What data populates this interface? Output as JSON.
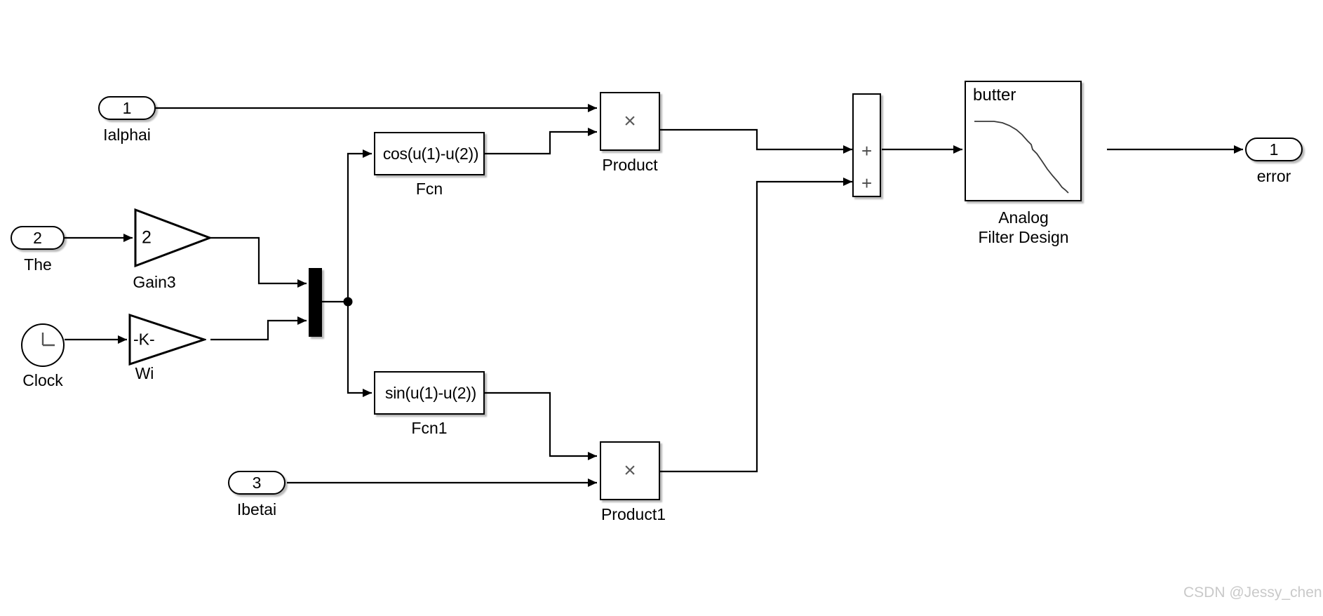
{
  "diagram": {
    "title": "Simulink block diagram",
    "watermark": "CSDN @Jessy_chen",
    "line_color": "#000000",
    "block_fill": "#ffffff"
  },
  "ports": {
    "in1": {
      "number": "1",
      "label": "Ialphai"
    },
    "in2": {
      "number": "2",
      "label": "The"
    },
    "in3": {
      "number": "3",
      "label": "Ibetai"
    },
    "out1": {
      "number": "1",
      "label": "error"
    }
  },
  "blocks": {
    "gain3": {
      "value": "2",
      "label": "Gain3"
    },
    "wi": {
      "value": "-K-",
      "label": "Wi"
    },
    "clock": {
      "label": "Clock",
      "icon": "clock-icon"
    },
    "mux": {
      "label": "",
      "icon": "mux-bar"
    },
    "fcn": {
      "expression": "cos(u(1)-u(2))",
      "label": "Fcn"
    },
    "fcn1": {
      "expression": "sin(u(1)-u(2))",
      "label": "Fcn1"
    },
    "product": {
      "symbol": "×",
      "label": "Product"
    },
    "product1": {
      "symbol": "×",
      "label": "Product1"
    },
    "sum": {
      "sign1": "+",
      "sign2": "+",
      "label": ""
    },
    "filter": {
      "type_label": "butter",
      "label": "Analog\nFilter Design",
      "icon": "lowpass-response-icon"
    }
  }
}
